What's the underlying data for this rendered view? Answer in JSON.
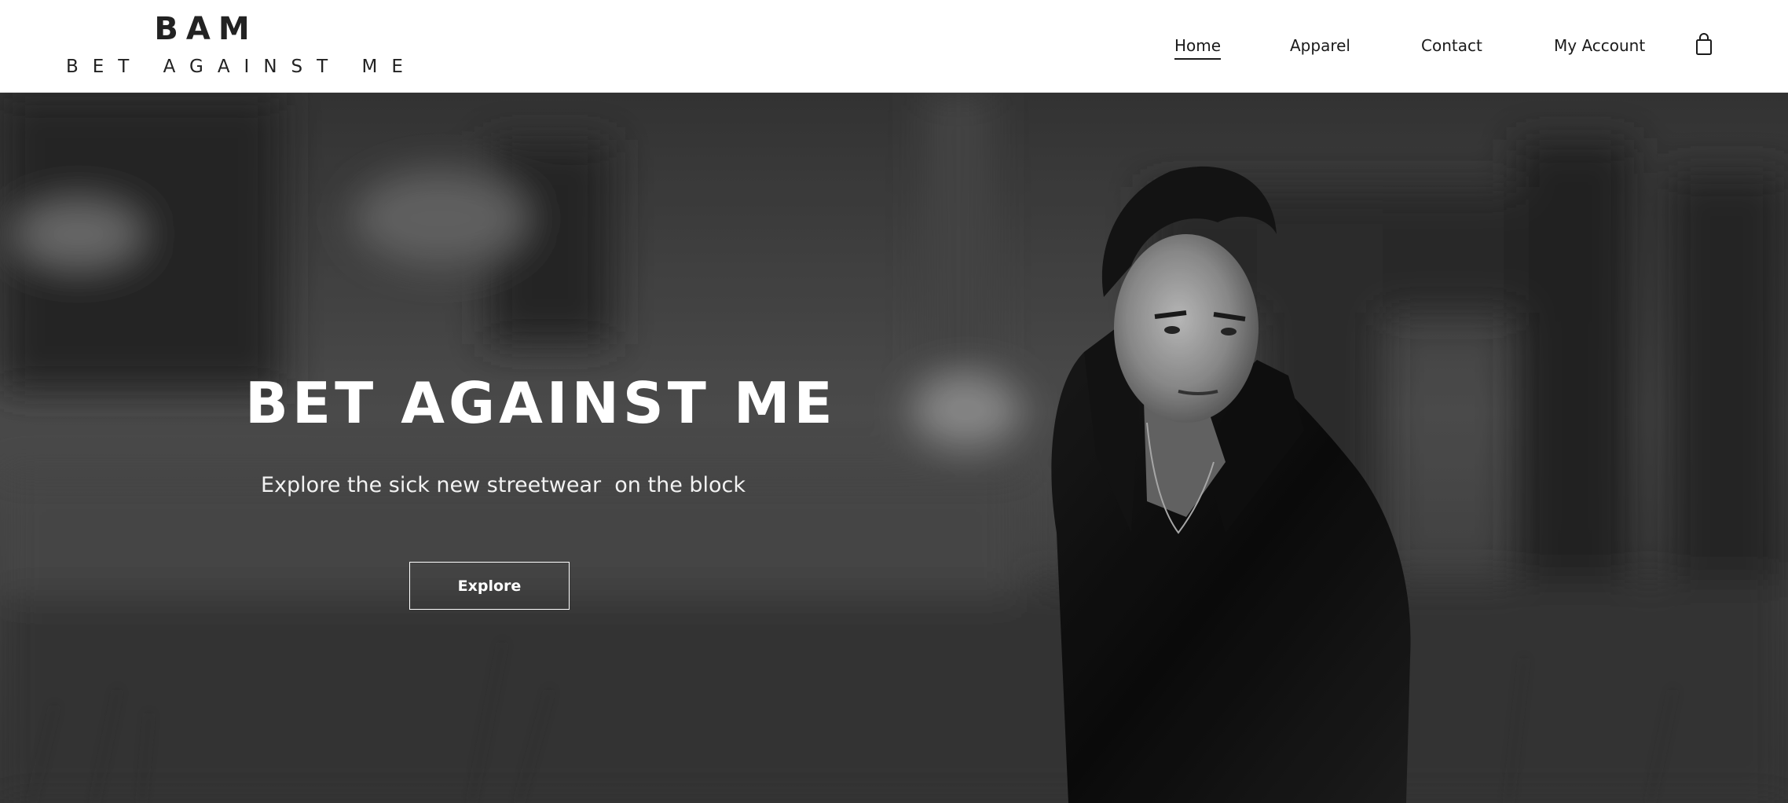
{
  "header": {
    "logo": {
      "mark": "BAM",
      "text": "BET AGAINST ME"
    },
    "nav": [
      {
        "label": "Home",
        "active": true
      },
      {
        "label": "Apparel",
        "active": false
      },
      {
        "label": "Contact",
        "active": false
      },
      {
        "label": "My Account",
        "active": false
      }
    ],
    "cart_icon": "shopping-bag-icon"
  },
  "hero": {
    "title": "BET AGAINST ME",
    "subtitle": "Explore the sick new streetwear  on the block",
    "button_label": "Explore",
    "image": "grayscale-man-in-leather-jacket-photo"
  },
  "colors": {
    "header_bg": "#ffffff",
    "text_dark": "#1a1a1a",
    "hero_text": "#ffffff"
  }
}
